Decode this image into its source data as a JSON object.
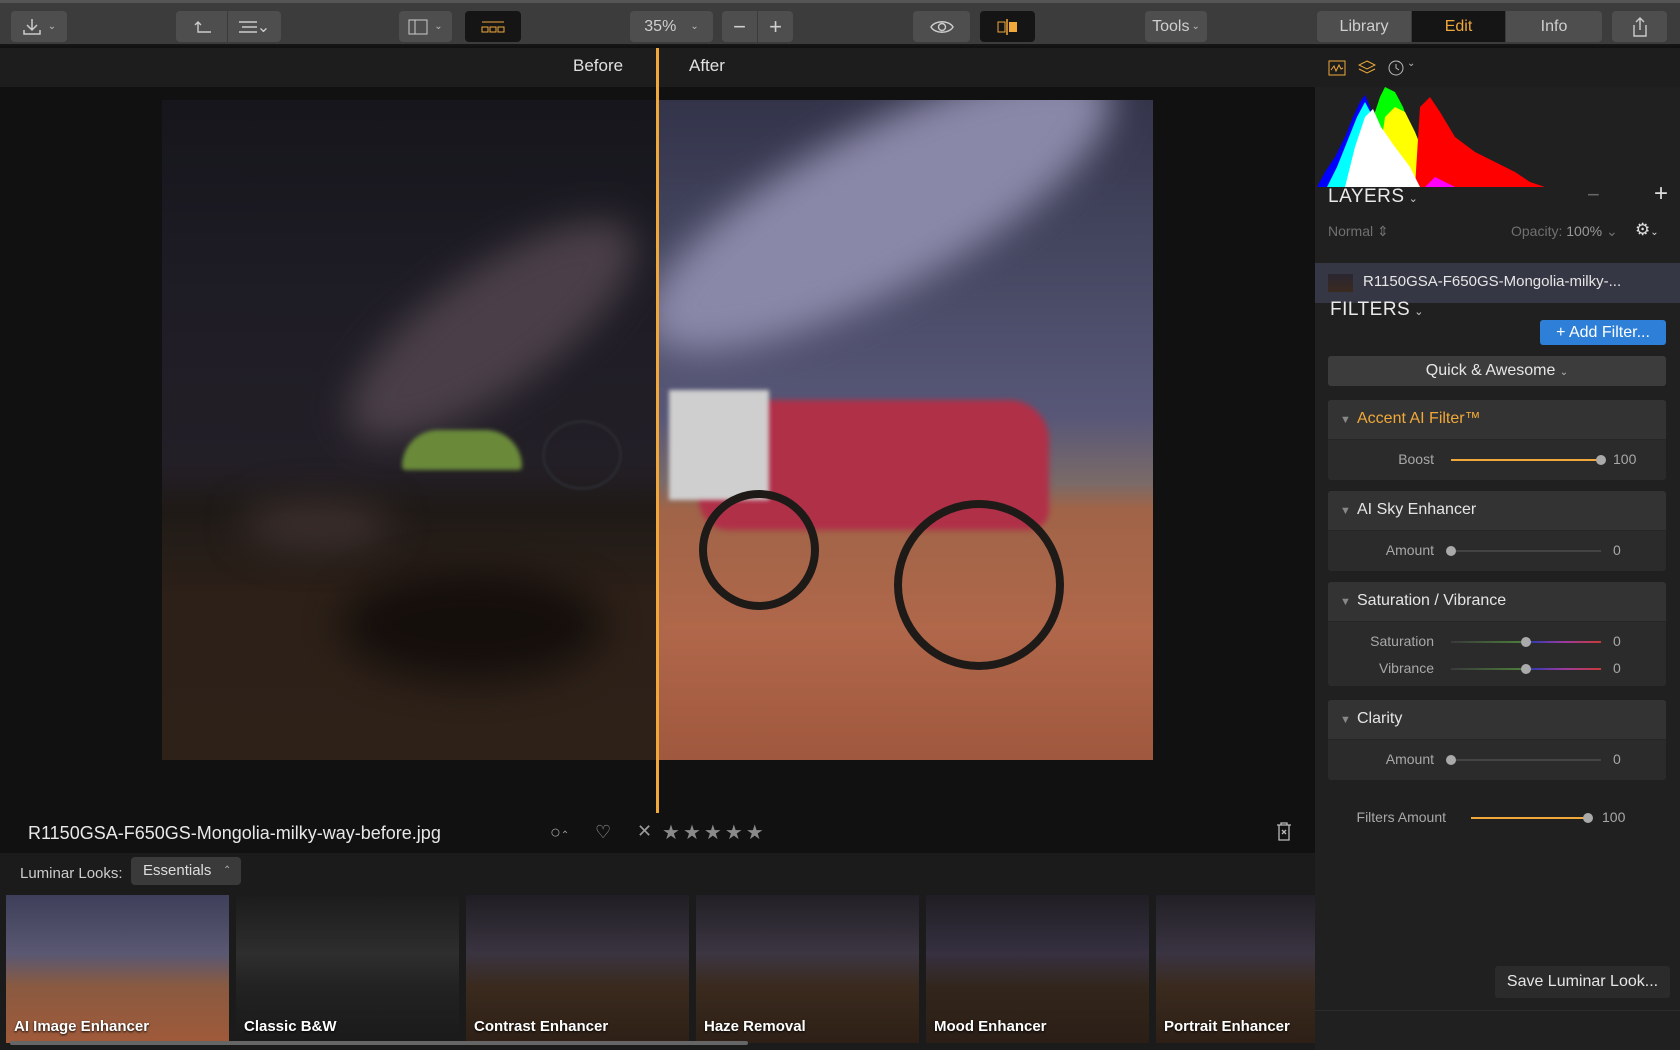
{
  "toolbar": {
    "zoom_value": "35%",
    "tools_label": "Tools",
    "mode_tabs": [
      {
        "label": "Library",
        "active": false
      },
      {
        "label": "Edit",
        "active": true
      },
      {
        "label": "Info",
        "active": false
      }
    ],
    "icons": {
      "import": "download-icon",
      "back": "return-arrow-icon",
      "list": "list-icon",
      "sidebar": "sidebar-toggle-icon",
      "filmstrip": "filmstrip-icon",
      "zoom_out": "minus-icon",
      "zoom_in": "plus-icon",
      "preview": "eye-icon",
      "compare": "before-after-icon",
      "share": "share-icon"
    }
  },
  "compare": {
    "before_label": "Before",
    "after_label": "After"
  },
  "image_info": {
    "filename": "R1150GSA-F650GS-Mongolia-milky-way-before.jpg",
    "rating_stars": 0,
    "max_stars": 5
  },
  "looks": {
    "label": "Luminar Looks:",
    "category": "Essentials",
    "items": [
      {
        "label": "AI Image Enhancer"
      },
      {
        "label": "Classic B&W"
      },
      {
        "label": "Contrast Enhancer"
      },
      {
        "label": "Haze Removal"
      },
      {
        "label": "Mood Enhancer"
      },
      {
        "label": "Portrait Enhancer"
      }
    ]
  },
  "right_panel": {
    "layers": {
      "title": "LAYERS",
      "blend_mode": "Normal",
      "opacity_label": "Opacity:",
      "opacity_value": "100%",
      "layer_name": "R1150GSA-F650GS-Mongolia-milky-..."
    },
    "filters": {
      "title": "FILTERS",
      "add_label": "+ Add Filter...",
      "preset": "Quick & Awesome",
      "panels": [
        {
          "title": "Accent AI Filter™",
          "accent": true,
          "sliders": [
            {
              "label": "Boost",
              "value": "100",
              "fraction": 1.0
            }
          ]
        },
        {
          "title": "AI Sky Enhancer",
          "accent": false,
          "sliders": [
            {
              "label": "Amount",
              "value": "0",
              "fraction": 0.0
            }
          ]
        },
        {
          "title": "Saturation / Vibrance",
          "accent": false,
          "sliders": [
            {
              "label": "Saturation",
              "value": "0",
              "fraction": 0.5
            },
            {
              "label": "Vibrance",
              "value": "0",
              "fraction": 0.5
            }
          ]
        },
        {
          "title": "Clarity",
          "accent": false,
          "sliders": [
            {
              "label": "Amount",
              "value": "0",
              "fraction": 0.0
            }
          ]
        }
      ],
      "filters_amount_label": "Filters Amount",
      "filters_amount_value": "100",
      "filters_amount_fraction": 1.0
    },
    "save_look_label": "Save Luminar Look..."
  },
  "colors": {
    "accent": "#f0a83a",
    "button_blue": "#2d7fd8"
  }
}
